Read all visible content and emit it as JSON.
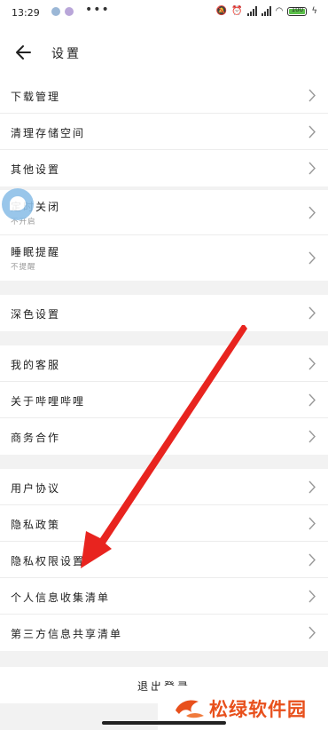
{
  "status_bar": {
    "time": "13:29",
    "more": "•••",
    "battery": "100"
  },
  "header": {
    "title": "设置"
  },
  "groups": [
    {
      "items": [
        {
          "label": "下载管理"
        },
        {
          "label": "清理存储空间"
        },
        {
          "label": "其他设置"
        }
      ]
    },
    {
      "items": [
        {
          "label": "定时关闭",
          "sub": "不开启"
        },
        {
          "label": "睡眠提醒",
          "sub": "不提醒"
        }
      ]
    },
    {
      "items": [
        {
          "label": "深色设置"
        }
      ]
    },
    {
      "items": [
        {
          "label": "我的客服"
        },
        {
          "label": "关于哔哩哔哩"
        },
        {
          "label": "商务合作"
        }
      ]
    },
    {
      "items": [
        {
          "label": "用户协议"
        },
        {
          "label": "隐私政策"
        },
        {
          "label": "隐私权限设置"
        },
        {
          "label": "个人信息收集清单"
        },
        {
          "label": "第三方信息共享清单"
        }
      ]
    }
  ],
  "logout": {
    "label": "退出登录"
  },
  "watermark": {
    "text": "松绿软件园"
  },
  "colors": {
    "arrow": "#e8241f",
    "watermark": "#e8501c",
    "accent_bubble": "#8ec0e8"
  }
}
